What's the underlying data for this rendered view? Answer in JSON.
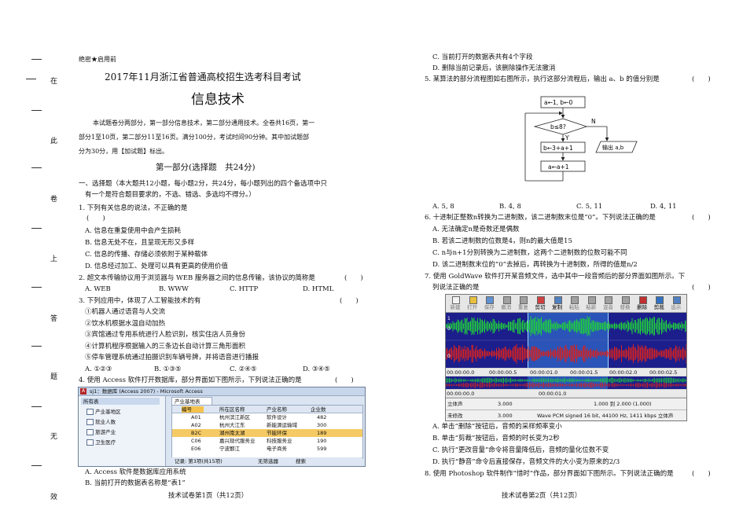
{
  "binding_margin": [
    "在",
    "此",
    "卷",
    "上",
    "答",
    "题",
    "无",
    "效"
  ],
  "header": {
    "secret": "绝密★启用前",
    "exam_title": "2017年11月浙江省普通高校招生选考科目考试",
    "subject": "信息技术",
    "intro_lines": [
      "本试题卷分两部分，第一部分信息技术，第二部分通用技术。全卷共16页，第一",
      "部分1至10页，第二部分11至16页。满分100分，考试时间90分钟。其中加试题部",
      "分为30分，用【加试题】标出。"
    ],
    "part_title": "第一部分(选择题　共24分)",
    "section_lines": [
      "一、选择题（本大题共12小题，每小题2分，共24分，每小题列出的四个备选项中只",
      "有一个是符合题目要求的，不选、错选、多选均不得分。）"
    ]
  },
  "left_questions": {
    "q1": {
      "stem": "1. 下列有关信息的说法，不正确的是",
      "paren": "(　　)",
      "options": [
        "A. 信息在重复使用中会产生损耗",
        "B. 信息无处不在，且呈现无形又多样",
        "C. 信息的传播、存储必须依附于某种载体",
        "D. 信息经过加工、处理可以具有更高的使用价值"
      ]
    },
    "q2": {
      "stem": "2. 超文本传输协议用于浏览器与 WEB 服务器之间的信息传输，该协议的简称是",
      "paren": "(　　)",
      "options": [
        "A. WEB",
        "B. WWW",
        "C. HTTP",
        "D. HTML"
      ]
    },
    "q3": {
      "stem": "3. 下列应用中，体现了人工智能技术的有",
      "paren": "(　　)",
      "items": [
        "①机器人通过语音与人交流",
        "②饮水机根据水温自动加热",
        "③宾馆通过专用系统进行人脸识别，核实住店人员身份",
        "④计算机程序根据输入的三条边长自动计算三角形面积",
        "⑤停车管理系统通过拍摄识别车辆号牌，并将语音进行播报"
      ],
      "options": [
        "A. ①②③",
        "B. ①③⑤",
        "C. ②④⑤",
        "D. ③④⑤"
      ]
    },
    "q4": {
      "stem": "4. 使用 Access 软件打开数据库，部分界面如下图所示，下列说法正确的是",
      "paren": "(　　)",
      "options": [
        "A. Access 软件是数据库应用系统",
        "B. 当前打开的数据表名称是“表1”"
      ]
    },
    "footer": "技术试卷第1页（共12页）"
  },
  "access_window": {
    "title": "sj1：数据库 (Access 2007) - Microsoft Access",
    "nav_header": "所有表",
    "nav_items": [
      "产业基地区",
      "就业人数",
      "旅游产业",
      "卫生医疗"
    ],
    "tab_label": "产业基地表",
    "columns": [
      "编号",
      "所在区名称",
      "产业名称",
      "企业数"
    ],
    "rows": [
      [
        "A01",
        "杭州滨江新区",
        "软件设计",
        "482"
      ],
      [
        "A02",
        "杭州大江东",
        "新能源运输域",
        "300"
      ],
      [
        "B2C",
        "湖州南太湖",
        "节能环保",
        "189"
      ],
      [
        "C06",
        "嘉兴现代服务业",
        "科技服务业",
        "190"
      ],
      [
        "E06",
        "宁波鄞江",
        "电子商务",
        "599"
      ]
    ],
    "status_record": "记录: 第3项(共15项)",
    "status_filter": "无筛选器",
    "status_search": "搜索"
  },
  "right_questions": {
    "q4_rest": [
      "C. 当前打开的数据表共有4个字段",
      "D. 删除当前记录后，该删除操作无法撤消"
    ],
    "q5": {
      "stem": "5. 某算法的部分流程图如右图所示，执行这部分流程后，输出 a、b 的值分别是",
      "paren": "(　　)",
      "options": [
        "A. 5, 8",
        "B. 4, 8",
        "C. 5, 11",
        "D. 4, 11"
      ]
    },
    "flow": {
      "init": "a←1, b←0",
      "cond": "b≤8?",
      "yes": "Y",
      "no": "N",
      "step1": "b←3+a+1",
      "step2": "a←a+1",
      "output": "输出 a,b"
    },
    "q6": {
      "stem": "6. 十进制正整数n转换为二进制数，该二进制数末位是“0”。下列说法正确的是",
      "paren": "(　　)",
      "options": [
        "A. 无法确定n是奇数还是偶数",
        "B. 若该二进制数的位数是4，则n的最大值是15",
        "C. n与n+1分别转换为二进制数，这两个二进制数的位数可能不同",
        "D. 该二进制数末位的“0”去掉后，再转换为十进制数，所得的值是n/2"
      ]
    },
    "q7": {
      "stem_lines": [
        "7. 使用 GoldWave 软件打开某音频文件，选中其中一段音频后的部分界面如图所示。下",
        "列说法正确的是"
      ],
      "paren": "(　　)",
      "options": [
        "A. 单击“删除”按钮后，音频的采样频率变小",
        "B. 单击“剪裁”按钮后，音频的时长变为2秒",
        "C. 执行“更改音量”命令将音量降低后，音频的量化位数不变",
        "D. 执行“静音”命令后直接保存，音频文件的大小变为原来的2/3"
      ]
    },
    "q8": {
      "stem": "8. 使用 Photoshop 软件制作“惜时”作品，部分界面如下图所示。下列说法正确的是",
      "paren": "(　　)"
    },
    "footer": "技术试卷第2页（共12页）"
  },
  "goldwave": {
    "toolbar": [
      "新建",
      "打开",
      "保存",
      "撤消",
      "重复",
      "剪切",
      "复制",
      "粘贴",
      "粘新",
      "混音",
      "替换",
      "删除",
      "剪裁",
      "选示"
    ],
    "time_left": [
      "00:00:00.0",
      "00:00:00.5",
      "00:00:01.0",
      "00:00:01.5",
      "00:00:02.0",
      "00:00:02.5"
    ],
    "time_mid": "00:00:01.0",
    "status_row1": [
      "立体声",
      "3.000",
      "1.000 到 2.000 (1.000)"
    ],
    "status_row2": [
      "未修改",
      "3.000",
      "Wave PCM signed 16 bit, 44100 Hz, 1411 kbps 立体声"
    ],
    "colors": {
      "wave_bg": "#1c1e8c",
      "wave_green": "#1fd23a",
      "wave_red": "#d8221e",
      "selection": "#3a7fd6"
    }
  }
}
